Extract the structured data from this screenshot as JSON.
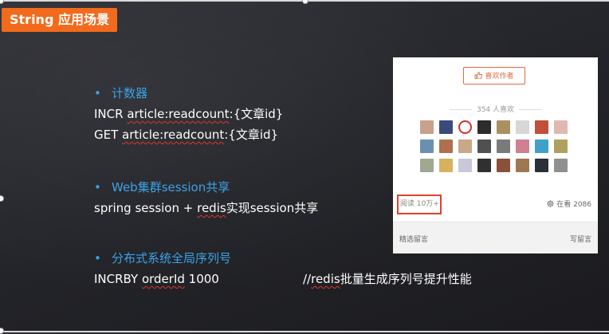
{
  "title": "String 应用场景",
  "sections": [
    {
      "heading": "计数器",
      "lines": [
        {
          "pre": "INCR ",
          "mark": "article:readcount",
          "post": ":{文章id}"
        },
        {
          "pre": "GET ",
          "mark": "article:readcount",
          "post": ":{文章id}"
        }
      ]
    },
    {
      "heading": "Web集群session共享",
      "lines": [
        {
          "pre": "spring session + ",
          "mark": "redis",
          "post": "实现session共享"
        }
      ]
    },
    {
      "heading": "分布式系统全局序列号",
      "lines": [
        {
          "pre": "INCRBY  ",
          "mark": "orderId",
          "post": "  1000",
          "comment_pre": "//",
          "comment_mark": "redis",
          "comment_post": "批量生成序列号提升性能"
        }
      ]
    }
  ],
  "bullet": "•",
  "panel": {
    "like_button": "喜欢作者",
    "likes_count": "354 人喜欢",
    "read_count": "阅读 10万+",
    "watching": "在看 2086",
    "footer_left": "精选留言",
    "footer_right": "写留言",
    "icons": {
      "like": "thumb-up-icon",
      "watching": "gear-icon"
    }
  },
  "colors": {
    "badge": "#f26b1d",
    "heading": "#3ba3e8",
    "squiggle": "#d9392b",
    "read_box": "#e0402c"
  }
}
